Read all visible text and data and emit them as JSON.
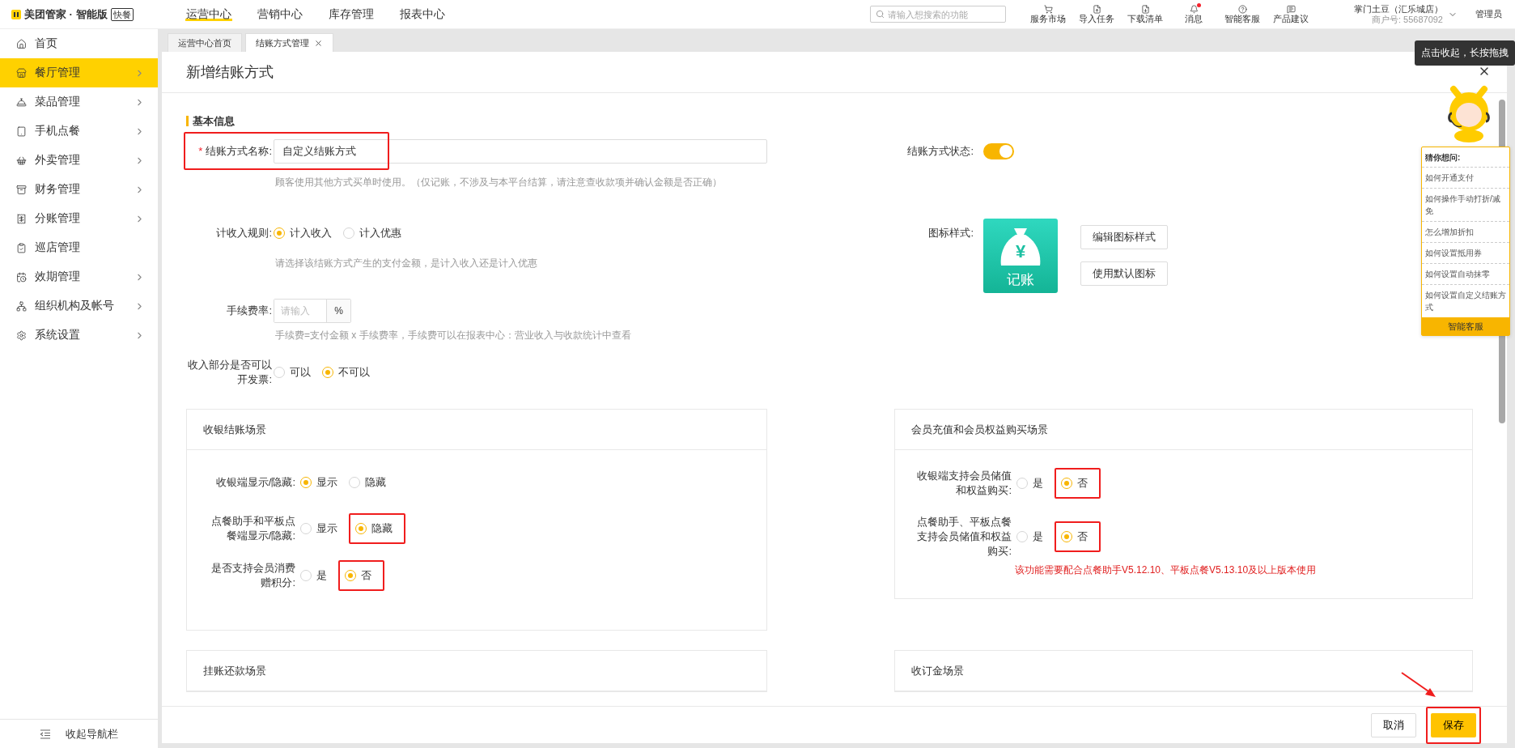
{
  "brand": {
    "name": "美团管家 · 智能版",
    "badge": "快餐"
  },
  "top_nav": [
    {
      "label": "运营中心",
      "selected": true
    },
    {
      "label": "营销中心",
      "selected": false
    },
    {
      "label": "库存管理",
      "selected": false
    },
    {
      "label": "报表中心",
      "selected": false
    }
  ],
  "search": {
    "placeholder": "请输入想搜索的功能"
  },
  "toolbar": [
    {
      "label": "服务市场",
      "kind": "cart",
      "unread": false
    },
    {
      "label": "导入任务",
      "kind": "upload",
      "unread": false
    },
    {
      "label": "下载清单",
      "kind": "download",
      "unread": false
    },
    {
      "label": "消息",
      "kind": "bell",
      "unread": true
    },
    {
      "label": "智能客服",
      "kind": "help",
      "unread": false
    },
    {
      "label": "产品建议",
      "kind": "message",
      "unread": false
    }
  ],
  "account": {
    "store": "掌门土豆（汇乐城店）",
    "merchant_no": "商户号: 55687092",
    "role": "管理员"
  },
  "sidebar": {
    "items": [
      {
        "label": "首页",
        "kind": "home",
        "selected": false,
        "expandable": false
      },
      {
        "label": "餐厅管理",
        "kind": "store",
        "selected": true,
        "expandable": true
      },
      {
        "label": "菜品管理",
        "kind": "dish",
        "selected": false,
        "expandable": true
      },
      {
        "label": "手机点餐",
        "kind": "tablet",
        "selected": false,
        "expandable": true
      },
      {
        "label": "外卖管理",
        "kind": "basket",
        "selected": false,
        "expandable": true
      },
      {
        "label": "财务管理",
        "kind": "finance",
        "selected": false,
        "expandable": true
      },
      {
        "label": "分账管理",
        "kind": "receipt",
        "selected": false,
        "expandable": true
      },
      {
        "label": "巡店管理",
        "kind": "inspect",
        "selected": false,
        "expandable": false
      },
      {
        "label": "效期管理",
        "kind": "calendar",
        "selected": false,
        "expandable": true
      },
      {
        "label": "组织机构及帐号",
        "kind": "org",
        "selected": false,
        "expandable": true
      },
      {
        "label": "系统设置",
        "kind": "settings",
        "selected": false,
        "expandable": true
      }
    ],
    "collapse": "收起导航栏"
  },
  "tabs": [
    {
      "label": "运营中心首页",
      "selected": false,
      "closable": false
    },
    {
      "label": "结账方式管理",
      "selected": true,
      "closable": true
    }
  ],
  "dialog": {
    "title": "新增结账方式",
    "section": "基本信息",
    "name_field": {
      "label": "结账方式名称:",
      "required_mark": "*",
      "value": "自定义结账方式",
      "highlighted": true,
      "hint": "顾客使用其他方式买单时使用。（仅记账，不涉及与本平台结算，请注意查收款项并确认金额是否正确）"
    },
    "income_rule": {
      "label": "计收入规则:",
      "options": [
        {
          "label": "计入收入",
          "selected": true
        },
        {
          "label": "计入优惠",
          "selected": false
        }
      ],
      "hint": "请选择该结账方式产生的支付金额，是计入收入还是计入优惠"
    },
    "fee_rate": {
      "label": "手续费率:",
      "placeholder": "请输入",
      "unit": "%",
      "hint": "手续费=支付金额 x 手续费率，手续费可以在报表中心：营业收入与收款统计中查看"
    },
    "invoice": {
      "label": "收入部分是否可以开发票:",
      "options": [
        {
          "label": "可以",
          "selected": false
        },
        {
          "label": "不可以",
          "selected": true
        }
      ]
    },
    "status": {
      "label": "结账方式状态:",
      "on": true
    },
    "icon_style": {
      "label": "图标样式:",
      "symbol": "¥",
      "caption": "记账",
      "buttons": [
        "编辑图标样式",
        "使用默认图标"
      ]
    },
    "cards": [
      {
        "title": "收银结账场景",
        "rows": [
          {
            "label": "收银端显示/隐藏:",
            "options": [
              {
                "label": "显示",
                "selected": true,
                "highlighted": false
              },
              {
                "label": "隐藏",
                "selected": false,
                "highlighted": false
              }
            ]
          },
          {
            "label": "点餐助手和平板点餐端显示/隐藏:",
            "options": [
              {
                "label": "显示",
                "selected": false,
                "highlighted": false
              },
              {
                "label": "隐藏",
                "selected": true,
                "highlighted": true
              }
            ]
          },
          {
            "label": "是否支持会员消费赠积分:",
            "options": [
              {
                "label": "是",
                "selected": false,
                "highlighted": false
              },
              {
                "label": "否",
                "selected": true,
                "highlighted": true
              }
            ]
          }
        ]
      },
      {
        "title": "会员充值和会员权益购买场景",
        "rows": [
          {
            "label": "收银端支持会员储值和权益购买:",
            "options": [
              {
                "label": "是",
                "selected": false,
                "highlighted": false
              },
              {
                "label": "否",
                "selected": true,
                "highlighted": true
              }
            ]
          },
          {
            "label": "点餐助手、平板点餐支持会员储值和权益购买:",
            "options": [
              {
                "label": "是",
                "selected": false,
                "highlighted": false
              },
              {
                "label": "否",
                "selected": true,
                "highlighted": true
              }
            ]
          }
        ],
        "note": "该功能需要配合点餐助手V5.12.10、平板点餐V5.13.10及以上版本使用"
      },
      {
        "title": "挂账还款场景"
      },
      {
        "title": "收订金场景"
      }
    ],
    "footer": {
      "cancel": "取消",
      "save": "保存",
      "save_highlighted": true
    }
  },
  "assistant": {
    "tooltip": "点击收起，长按拖拽",
    "heading": "猜你想问:",
    "questions": [
      "如何开通支付",
      "如何操作手动打折/减免",
      "怎么增加折扣",
      "如何设置抵用券",
      "如何设置自动抹零",
      "如何设置自定义结账方式"
    ],
    "button": "智能客服"
  }
}
